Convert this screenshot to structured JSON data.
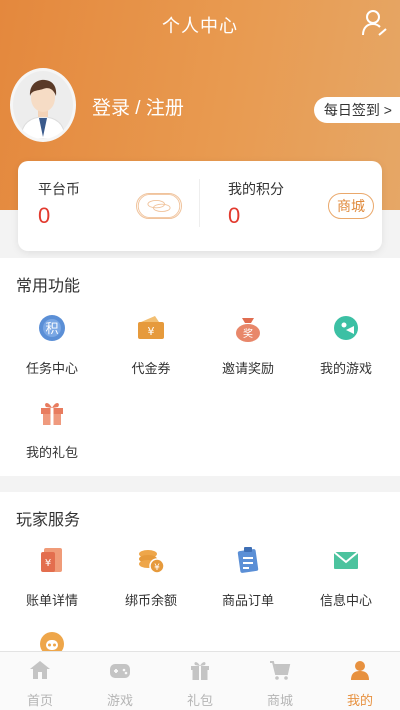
{
  "header": {
    "title": "个人中心"
  },
  "profile": {
    "login_label": "登录 / 注册",
    "signin_label": "每日签到 >"
  },
  "wallet": {
    "platform_coin_label": "平台币",
    "platform_coin_value": "0",
    "points_label": "我的积分",
    "points_value": "0",
    "mall_label": "商城"
  },
  "common": {
    "title": "常用功能",
    "items": [
      {
        "label": "任务中心",
        "icon": "task-icon"
      },
      {
        "label": "代金券",
        "icon": "voucher-icon"
      },
      {
        "label": "邀请奖励",
        "icon": "invite-reward-icon"
      },
      {
        "label": "我的游戏",
        "icon": "game-icon"
      },
      {
        "label": "我的礼包",
        "icon": "gift-icon"
      }
    ]
  },
  "services": {
    "title": "玩家服务",
    "items": [
      {
        "label": "账单详情",
        "icon": "bill-icon"
      },
      {
        "label": "绑币余额",
        "icon": "coins-icon"
      },
      {
        "label": "商品订单",
        "icon": "order-icon"
      },
      {
        "label": "信息中心",
        "icon": "mail-icon"
      }
    ]
  },
  "tabbar": {
    "items": [
      {
        "label": "首页",
        "icon": "home-icon"
      },
      {
        "label": "游戏",
        "icon": "gamepad-icon"
      },
      {
        "label": "礼包",
        "icon": "gift-icon"
      },
      {
        "label": "商城",
        "icon": "cart-icon"
      },
      {
        "label": "我的",
        "icon": "user-icon"
      }
    ],
    "active_color": "#e7913f",
    "inactive_color": "#b5b5b5"
  },
  "colors": {
    "accent": "#e4883d",
    "value_red": "#e23a2e"
  }
}
